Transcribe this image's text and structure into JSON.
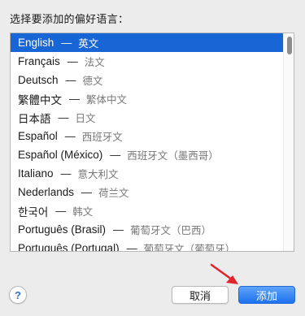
{
  "dialog": {
    "prompt": "选择要添加的偏好语言：",
    "languages": [
      {
        "native": "English",
        "local": "英文",
        "selected": true
      },
      {
        "native": "Français",
        "local": "法文"
      },
      {
        "native": "Deutsch",
        "local": "德文"
      },
      {
        "native": "繁體中文",
        "local": "繁体中文"
      },
      {
        "native": "日本語",
        "local": "日文"
      },
      {
        "native": "Español",
        "local": "西班牙文"
      },
      {
        "native": "Español (México)",
        "local": "西班牙文（墨西哥）"
      },
      {
        "native": "Italiano",
        "local": "意大利文"
      },
      {
        "native": "Nederlands",
        "local": "荷兰文"
      },
      {
        "native": "한국어",
        "local": "韩文"
      },
      {
        "native": "Português (Brasil)",
        "local": "葡萄牙文（巴西）"
      },
      {
        "native": "Português (Portugal)",
        "local": "葡萄牙文（葡萄牙）"
      }
    ],
    "separator": "—",
    "help_label": "?",
    "cancel_label": "取消",
    "add_label": "添加"
  },
  "colors": {
    "selection": "#1866d6",
    "primary_button": "#1d72ee",
    "annotation_arrow": "#e0242b"
  }
}
